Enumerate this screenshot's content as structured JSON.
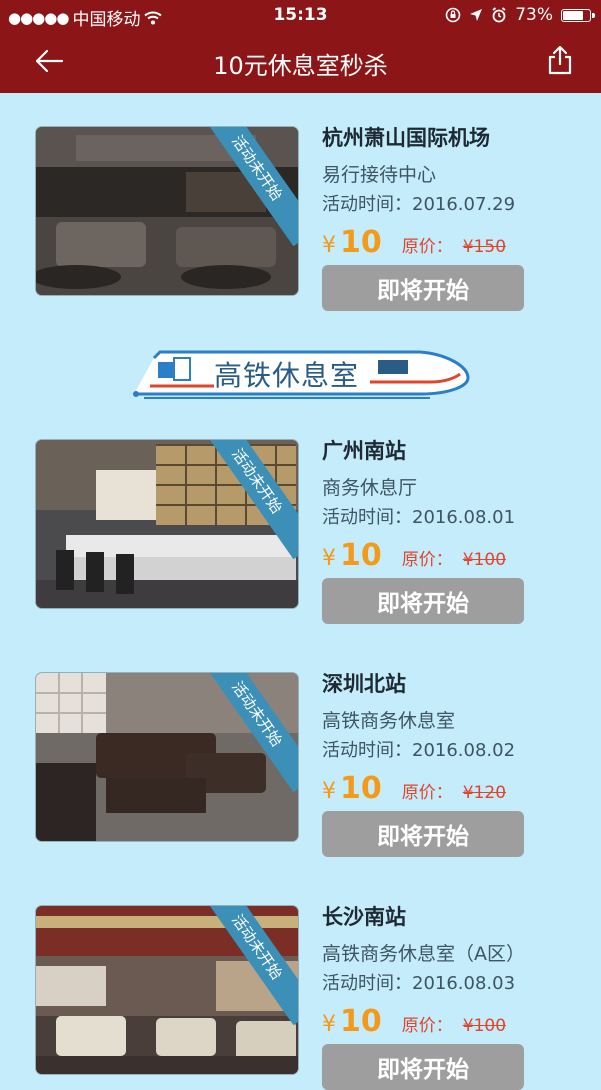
{
  "status": {
    "carrier": "中国移动",
    "time": "15:13",
    "battery": "73%"
  },
  "header": {
    "title": "10元休息室秒杀"
  },
  "section_banner": {
    "title": "高铁休息室"
  },
  "cards": [
    {
      "ribbon": "活动未开始",
      "name": "杭州萧山国际机场",
      "sub": "易行接待中心",
      "time": "活动时间：2016.07.29",
      "yen": "¥",
      "price": "10",
      "orig_label": "原价：",
      "orig_price": "¥150",
      "button": "即将开始"
    },
    {
      "ribbon": "活动未开始",
      "name": "广州南站",
      "sub": "商务休息厅",
      "time": "活动时间：2016.08.01",
      "yen": "¥",
      "price": "10",
      "orig_label": "原价：",
      "orig_price": "¥100",
      "button": "即将开始"
    },
    {
      "ribbon": "活动未开始",
      "name": "深圳北站",
      "sub": "高铁商务休息室",
      "time": "活动时间：2016.08.02",
      "yen": "¥",
      "price": "10",
      "orig_label": "原价：",
      "orig_price": "¥120",
      "button": "即将开始"
    },
    {
      "ribbon": "活动未开始",
      "name": "长沙南站",
      "sub": "高铁商务休息室（A区）",
      "time": "活动时间：2016.08.03",
      "yen": "¥",
      "price": "10",
      "orig_label": "原价：",
      "orig_price": "¥100",
      "button": "即将开始"
    }
  ],
  "colors": {
    "header_bg": "#8c1517",
    "page_bg": "#c5ecfa",
    "price": "#f39a1a",
    "orig_price": "#e0462c",
    "button_bg": "#9e9e9e",
    "ribbon_bg": "#3c8fb6"
  }
}
